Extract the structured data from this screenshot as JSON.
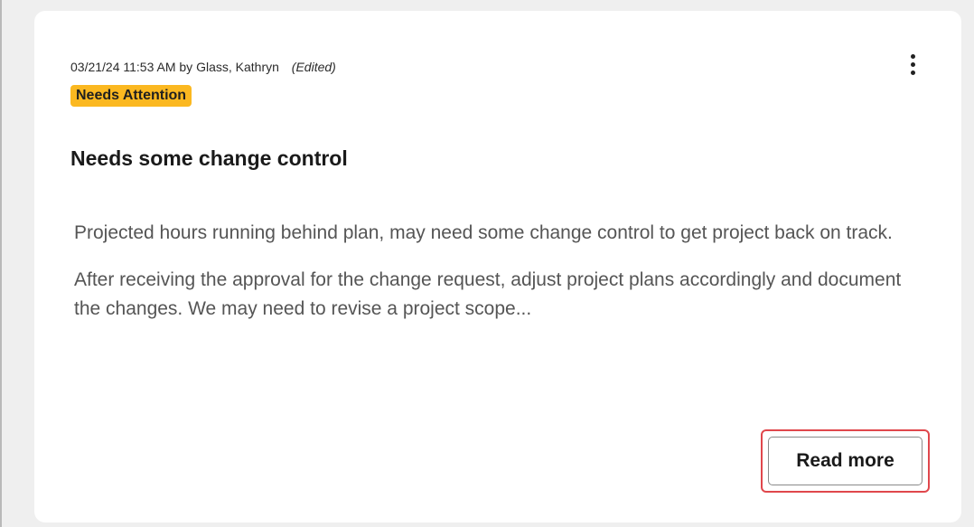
{
  "note": {
    "meta": {
      "timestamp": "03/21/24 11:53 AM",
      "by_label": "by",
      "author": "Glass, Kathryn",
      "edited_label": "(Edited)"
    },
    "status_badge": "Needs Attention",
    "title": "Needs some change control",
    "paragraphs": [
      "Projected hours running behind plan, may need some change control to get project back on track.",
      "After receiving the approval for the change request, adjust project plans accordingly and document the changes. We may need to revise a project scope..."
    ],
    "read_more_label": "Read more",
    "more_actions_icon": "vertical-ellipsis-icon"
  },
  "colors": {
    "badge_bg": "#fbb820",
    "highlight_border": "#e0474c",
    "card_bg": "#ffffff",
    "page_bg": "#efefef"
  }
}
